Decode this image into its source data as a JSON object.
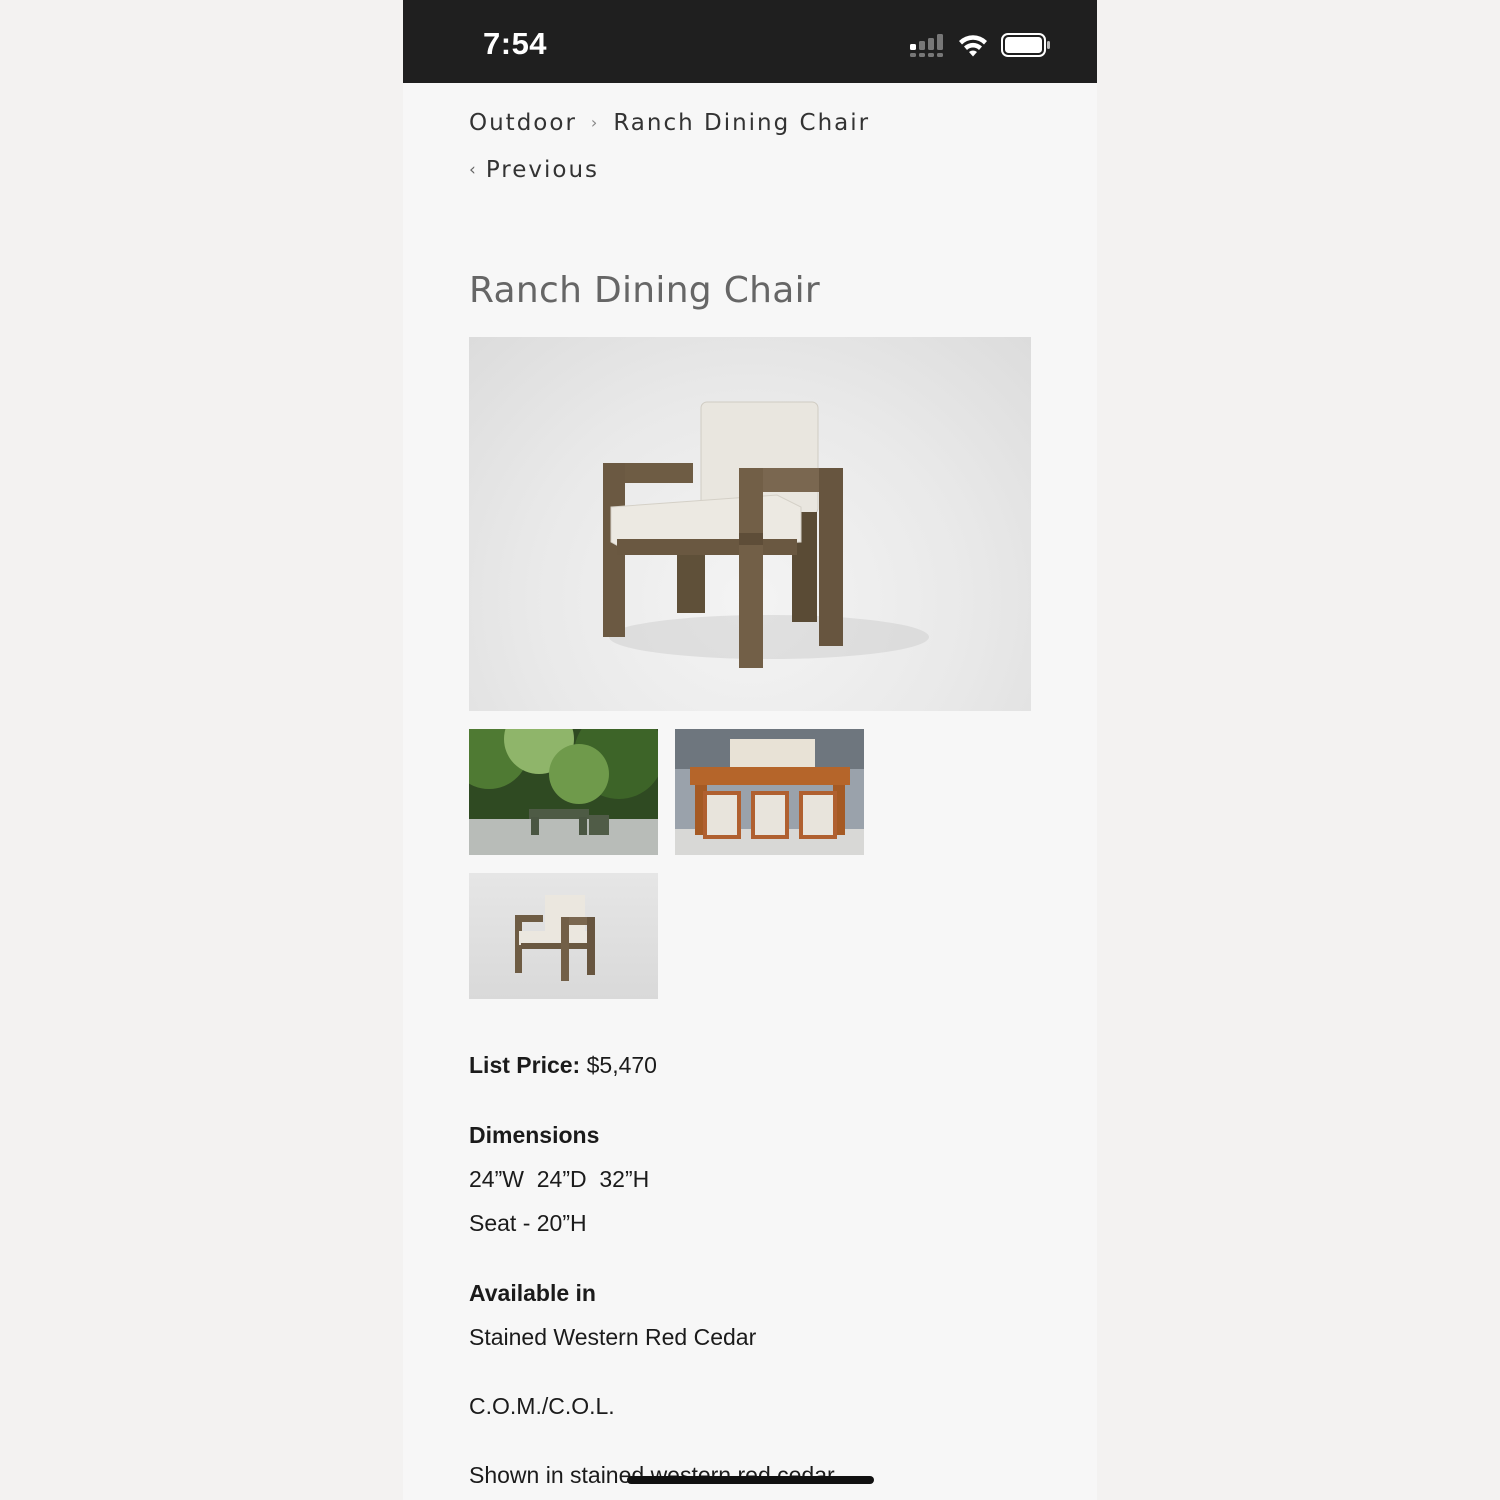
{
  "status_bar": {
    "time": "7:54"
  },
  "breadcrumb": {
    "parent": "Outdoor",
    "separator": "›",
    "current": "Ranch Dining Chair"
  },
  "nav": {
    "previous_chevron": "‹",
    "previous_label": "Previous"
  },
  "product": {
    "title": "Ranch Dining Chair",
    "list_price_label": "List Price:",
    "list_price_value": "$5,470",
    "dimensions_heading": "Dimensions",
    "dimensions_main": "24”W  24”D  32”H",
    "dimensions_seat": "Seat - 20”H",
    "available_heading": "Available in",
    "available_material": "Stained Western Red Cedar",
    "com_col": "C.O.M./C.O.L.",
    "shown_in": "Shown in stained western red cedar"
  },
  "colors": {
    "status_bar_bg": "#1f1f1f",
    "page_bg": "#f7f7f7",
    "chair_wood": "#6e5c44",
    "cushion": "#e8e4dc",
    "cedar_table": "#b5652a",
    "foliage": "#3f6b2e"
  }
}
